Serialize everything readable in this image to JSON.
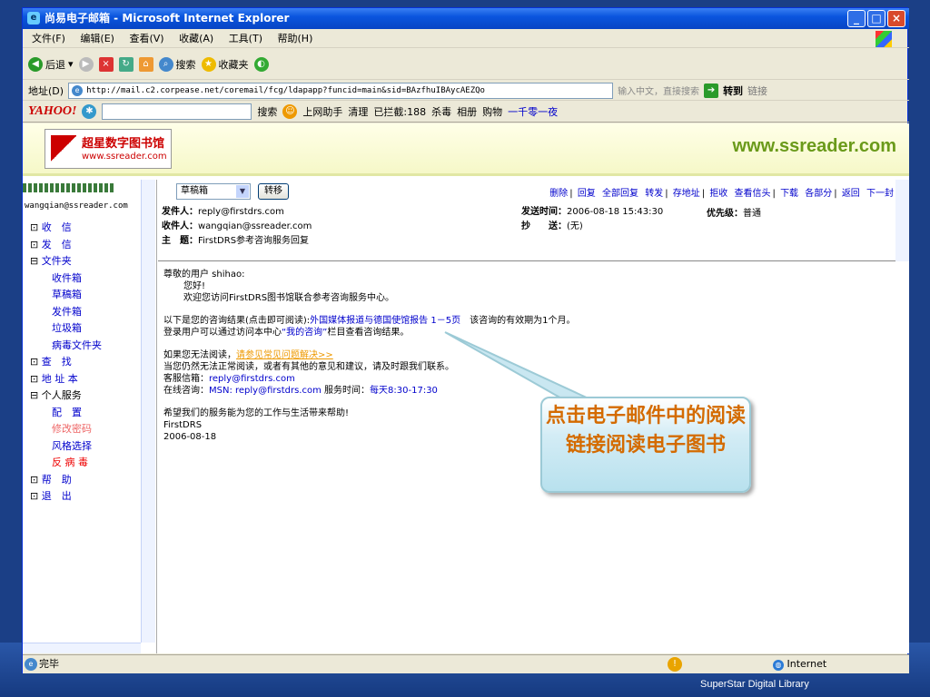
{
  "window": {
    "title": "尚易电子邮箱 - Microsoft Internet Explorer"
  },
  "menu": [
    "文件(F)",
    "编辑(E)",
    "查看(V)",
    "收藏(A)",
    "工具(T)",
    "帮助(H)"
  ],
  "toolbar": {
    "back": "后退",
    "search": "搜索",
    "favorites": "收藏夹"
  },
  "address": {
    "label": "地址(D)",
    "url": "http://mail.c2.corpease.net/coremail/fcg/ldapapp?funcid=main&sid=BAzfhuIBAycAEZQo",
    "hint": "输入中文，直接搜索",
    "go": "转到",
    "links": "链接"
  },
  "yahoo": {
    "logo": "YAHOO!",
    "search": "搜索",
    "helper": "上网助手",
    "clean": "清理",
    "blocked": "已拦截:188",
    "antivirus": "杀毒",
    "album": "相册",
    "shop": "购物",
    "link": "一千零一夜"
  },
  "banner": {
    "logo_cn": "超星数字图书馆",
    "logo_url": "www.ssreader.com",
    "site": "www.ssreader.com"
  },
  "sidebar": {
    "user": "wangqian@ssreader.com",
    "items": [
      "收　信",
      "发　信",
      "文件夹",
      "收件箱",
      "草稿箱",
      "发件箱",
      "垃圾箱",
      "病毒文件夹",
      "查　找",
      "地 址 本",
      "个人服务",
      "配　置",
      "修改密码",
      "风格选择",
      "反 病 毒",
      "帮　助",
      "退　出"
    ]
  },
  "mail": {
    "folder": "草稿箱",
    "move_btn": "转移",
    "actions": [
      "删除",
      "回复",
      "全部回复",
      "转发",
      "存地址",
      "拒收",
      "查看信头",
      "下载",
      "各部分",
      "返回",
      "下一封"
    ],
    "from_label": "发件人：",
    "from": "reply@firstdrs.com",
    "to_label": "收件人：",
    "to": "wangqian@ssreader.com",
    "subject_label": "主　题：",
    "subject": "FirstDRS参考咨询服务回复",
    "sent_label": "发送时间：",
    "sent": "2006-08-18 15:43:30",
    "cc_label": "抄　　送：",
    "cc": "(无)",
    "priority_label": "优先级：",
    "priority": "普通"
  },
  "body": {
    "greeting": "尊敬的用户 shihao:",
    "hello": "您好!",
    "welcome": "欢迎您访问FirstDRS图书馆联合参考咨询服务中心。",
    "result_pre": "以下是您的咨询结果(点击即可阅读):",
    "result_link": "外国媒体报道与德国使馆报告 1－5页",
    "result_post": "　该咨询的有效期为1个月。",
    "login_pre": "登录用户可以通过访问本中心",
    "login_link": "“我的咨询”",
    "login_post": "栏目查看咨询结果。",
    "noread_pre": "如果您无法阅读，",
    "noread_link": "请参见常见问题解决>>",
    "feedback": "当您仍然无法正常阅读，或者有其他的意见和建议，请及时跟我们联系。",
    "email_label": "客服信箱：",
    "email": "reply@firstdrs.com",
    "online_label": "在线咨询：",
    "online": "MSN: reply@firstdrs.com",
    "hours_label": " 服务时间：",
    "hours": "每天8:30-17:30",
    "wish": "希望我们的服务能为您的工作与生活带来帮助!",
    "sign": "FirstDRS",
    "date": "2006-08-18"
  },
  "callout": {
    "text": "点击电子邮件中的阅读链接阅读电子图书"
  },
  "status": {
    "done": "完毕",
    "zone": "Internet"
  },
  "footer": {
    "brand": "SuperStar Digital Library"
  }
}
